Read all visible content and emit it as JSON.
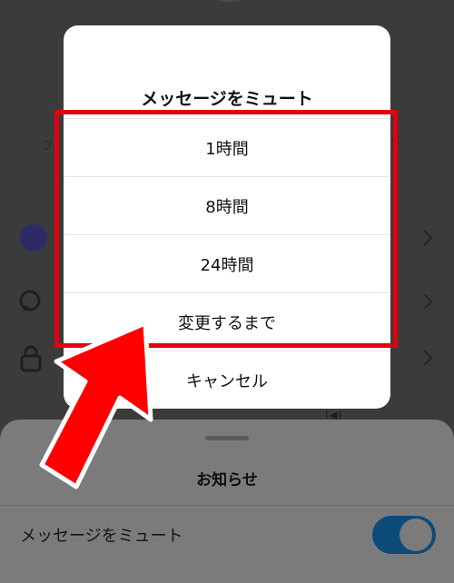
{
  "background": {
    "tab_left_text": "フ",
    "tab_right_text": ">",
    "small_text": "I◀I",
    "chevron": ">"
  },
  "dialog": {
    "title": "メッセージをミュート",
    "options": [
      {
        "label": "1時間"
      },
      {
        "label": "8時間"
      },
      {
        "label": "24時間"
      },
      {
        "label": "変更するまで"
      }
    ],
    "cancel_label": "キャンセル"
  },
  "sheet": {
    "title": "お知らせ",
    "row_label": "メッセージをミュート",
    "toggle_on": true
  },
  "colors": {
    "highlight": "#e3000f",
    "arrow": "#ff0000",
    "toggle": "#0c4a7a"
  },
  "icons": {
    "search": "speech-bubble-icon",
    "lock": "lock-icon"
  }
}
